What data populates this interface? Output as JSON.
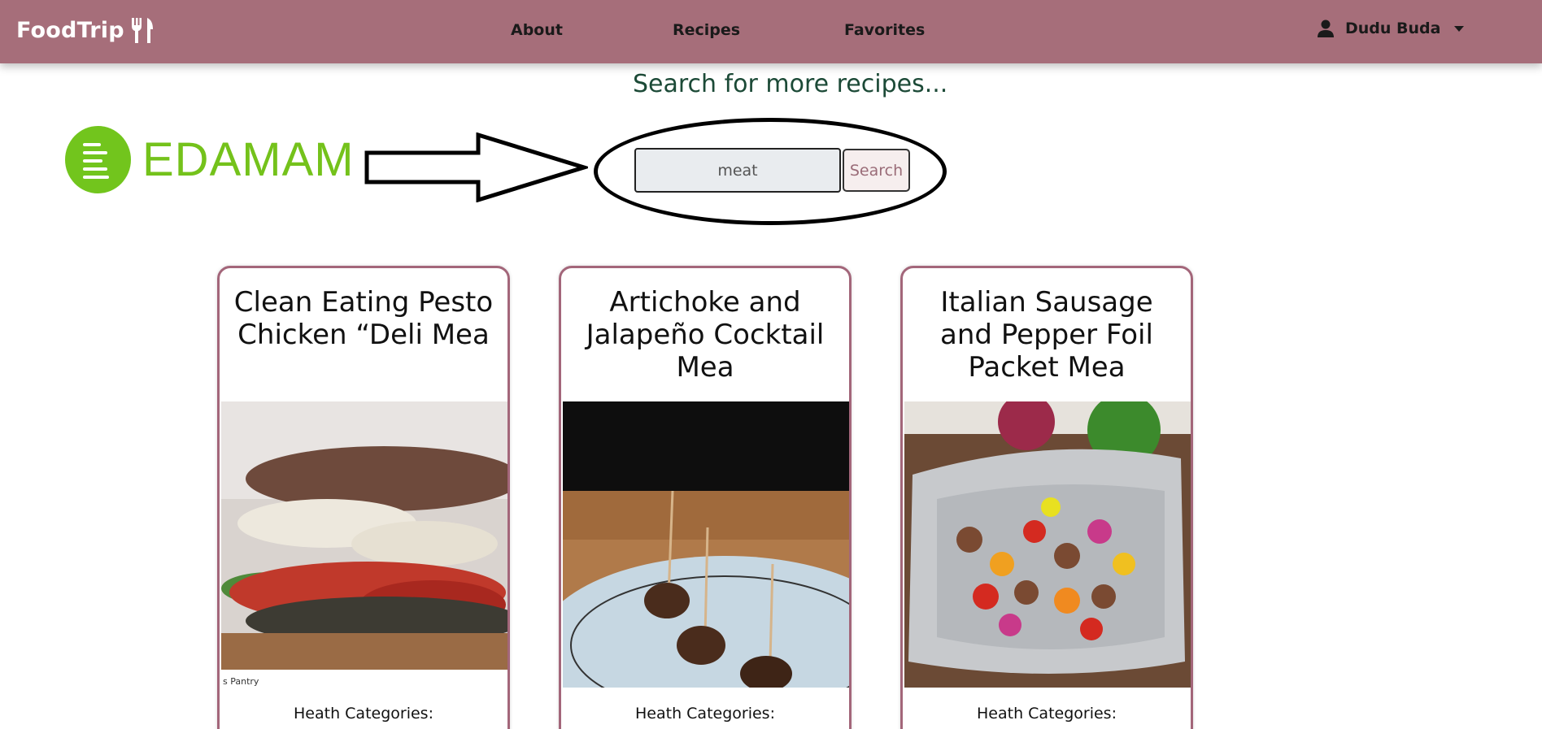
{
  "navbar": {
    "brand": "FoodTrip",
    "links": [
      "About",
      "Recipes",
      "Favorites"
    ],
    "user_name": "Dudu Buda",
    "bg_color": "#a66e7a"
  },
  "search": {
    "heading": "Search for more recipes...",
    "input_value": "meat",
    "button_label": "Search",
    "logo_text": "EDAMAM",
    "logo_color": "#74c21b"
  },
  "recipes": [
    {
      "title": "Clean Eating Pesto Chicken “Deli Mea",
      "category_label": "Heath Categories:",
      "image": "sandwich-photo"
    },
    {
      "title": "Artichoke and Jalapeño Cocktail Mea",
      "category_label": "Heath Categories:",
      "image": "meatballs-photo"
    },
    {
      "title": "Italian Sausage and Pepper Foil Packet Mea",
      "category_label": "Heath Categories:",
      "image": "foil-packet-photo"
    }
  ]
}
